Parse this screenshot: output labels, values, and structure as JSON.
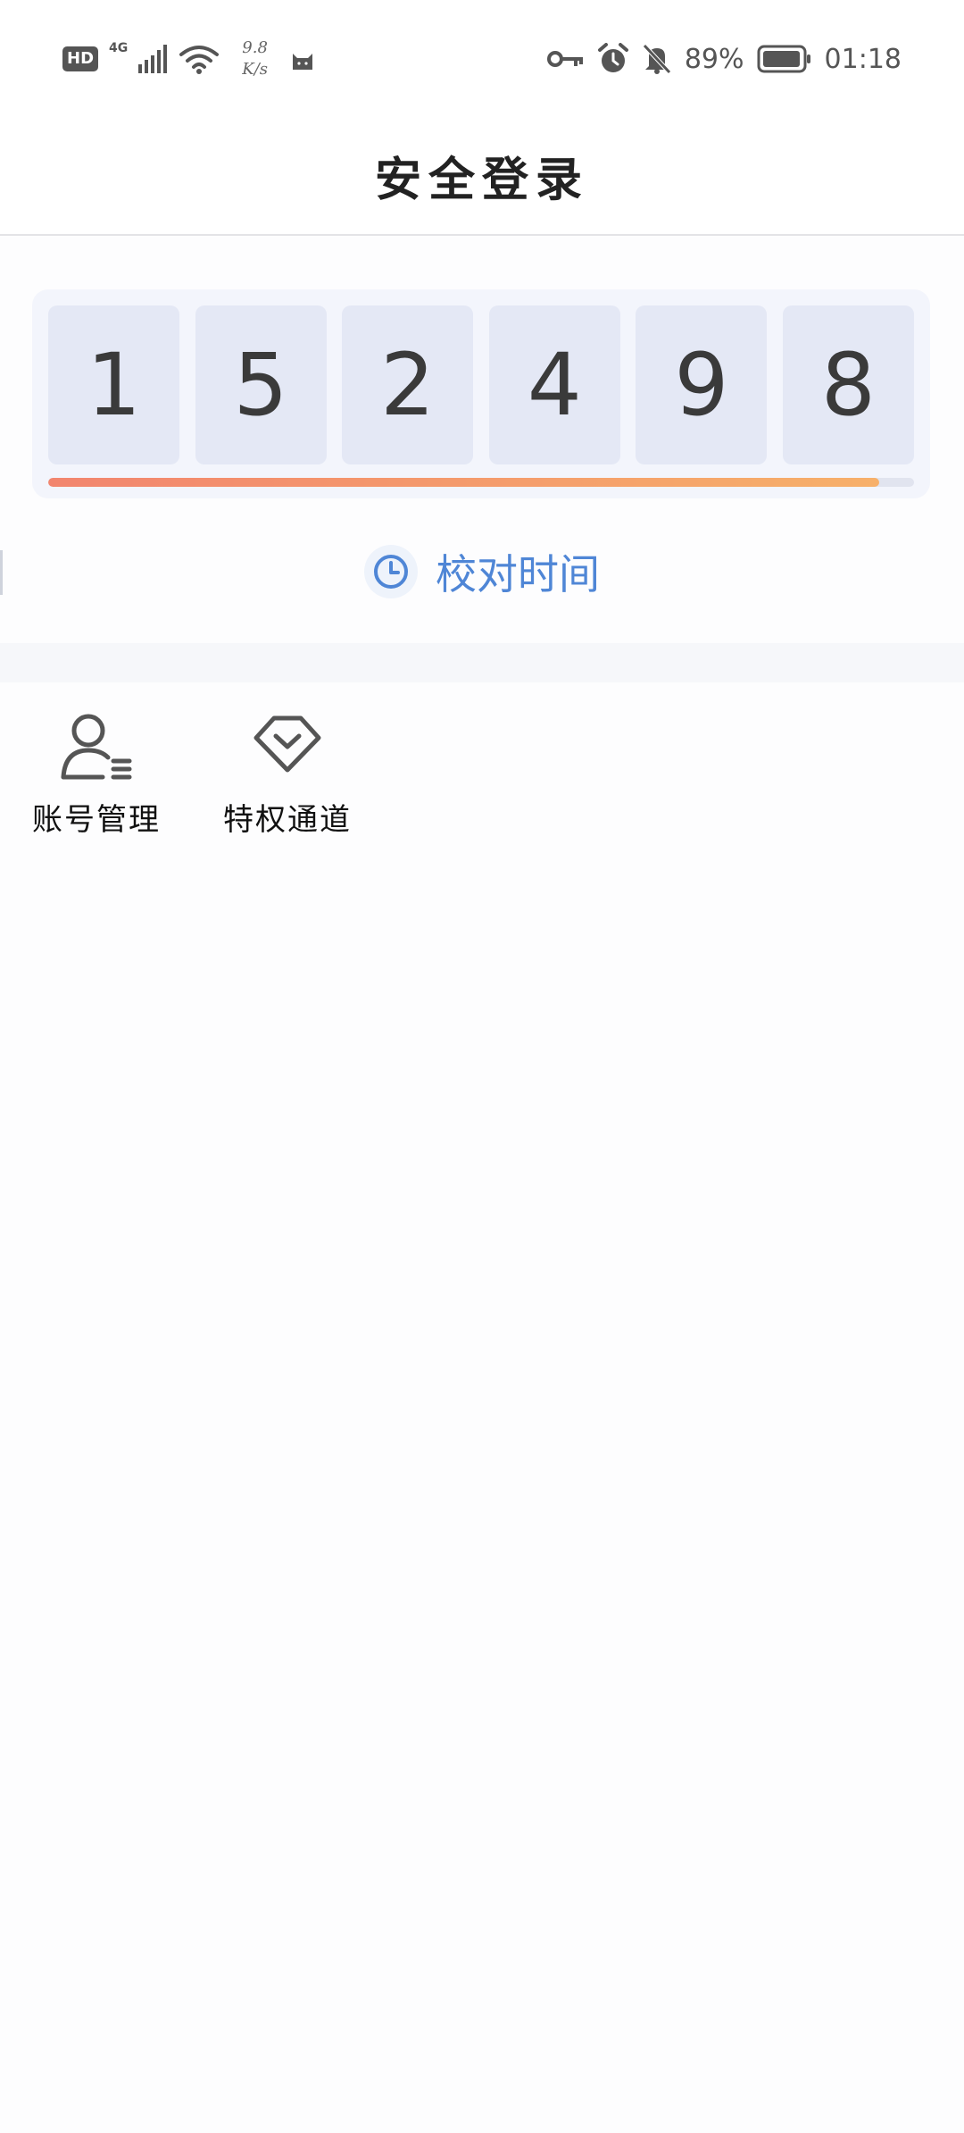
{
  "status_bar": {
    "hd": "HD",
    "network": "4G",
    "speed_value": "9.8",
    "speed_unit": "K/s",
    "battery_percent": "89%",
    "time": "01:18"
  },
  "header": {
    "title": "安全登录"
  },
  "code": {
    "digits": [
      "1",
      "5",
      "2",
      "4",
      "9",
      "8"
    ],
    "progress": 0.96
  },
  "calibrate": {
    "label": "校对时间",
    "icon": "clock-icon"
  },
  "menu": {
    "items": [
      {
        "label": "账号管理",
        "icon": "user-list-icon"
      },
      {
        "label": "特权通道",
        "icon": "diamond-icon"
      }
    ]
  },
  "colors": {
    "accent_blue": "#4f86d6",
    "progress_start": "#f2856e",
    "progress_end": "#f7b06a",
    "digit_box": "#e4e8f5"
  }
}
